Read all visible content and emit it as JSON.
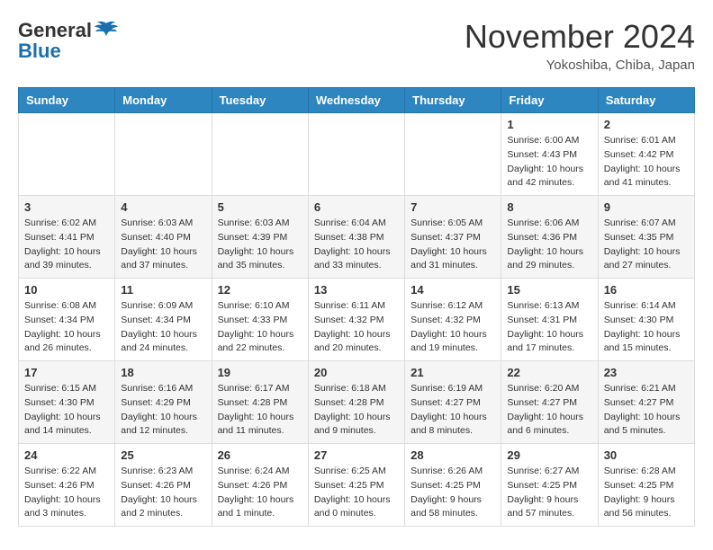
{
  "header": {
    "logo_line1": "General",
    "logo_line2": "Blue",
    "month": "November 2024",
    "location": "Yokoshiba, Chiba, Japan"
  },
  "weekdays": [
    "Sunday",
    "Monday",
    "Tuesday",
    "Wednesday",
    "Thursday",
    "Friday",
    "Saturday"
  ],
  "weeks": [
    [
      {
        "day": "",
        "info": ""
      },
      {
        "day": "",
        "info": ""
      },
      {
        "day": "",
        "info": ""
      },
      {
        "day": "",
        "info": ""
      },
      {
        "day": "",
        "info": ""
      },
      {
        "day": "1",
        "info": "Sunrise: 6:00 AM\nSunset: 4:43 PM\nDaylight: 10 hours\nand 42 minutes."
      },
      {
        "day": "2",
        "info": "Sunrise: 6:01 AM\nSunset: 4:42 PM\nDaylight: 10 hours\nand 41 minutes."
      }
    ],
    [
      {
        "day": "3",
        "info": "Sunrise: 6:02 AM\nSunset: 4:41 PM\nDaylight: 10 hours\nand 39 minutes."
      },
      {
        "day": "4",
        "info": "Sunrise: 6:03 AM\nSunset: 4:40 PM\nDaylight: 10 hours\nand 37 minutes."
      },
      {
        "day": "5",
        "info": "Sunrise: 6:03 AM\nSunset: 4:39 PM\nDaylight: 10 hours\nand 35 minutes."
      },
      {
        "day": "6",
        "info": "Sunrise: 6:04 AM\nSunset: 4:38 PM\nDaylight: 10 hours\nand 33 minutes."
      },
      {
        "day": "7",
        "info": "Sunrise: 6:05 AM\nSunset: 4:37 PM\nDaylight: 10 hours\nand 31 minutes."
      },
      {
        "day": "8",
        "info": "Sunrise: 6:06 AM\nSunset: 4:36 PM\nDaylight: 10 hours\nand 29 minutes."
      },
      {
        "day": "9",
        "info": "Sunrise: 6:07 AM\nSunset: 4:35 PM\nDaylight: 10 hours\nand 27 minutes."
      }
    ],
    [
      {
        "day": "10",
        "info": "Sunrise: 6:08 AM\nSunset: 4:34 PM\nDaylight: 10 hours\nand 26 minutes."
      },
      {
        "day": "11",
        "info": "Sunrise: 6:09 AM\nSunset: 4:34 PM\nDaylight: 10 hours\nand 24 minutes."
      },
      {
        "day": "12",
        "info": "Sunrise: 6:10 AM\nSunset: 4:33 PM\nDaylight: 10 hours\nand 22 minutes."
      },
      {
        "day": "13",
        "info": "Sunrise: 6:11 AM\nSunset: 4:32 PM\nDaylight: 10 hours\nand 20 minutes."
      },
      {
        "day": "14",
        "info": "Sunrise: 6:12 AM\nSunset: 4:32 PM\nDaylight: 10 hours\nand 19 minutes."
      },
      {
        "day": "15",
        "info": "Sunrise: 6:13 AM\nSunset: 4:31 PM\nDaylight: 10 hours\nand 17 minutes."
      },
      {
        "day": "16",
        "info": "Sunrise: 6:14 AM\nSunset: 4:30 PM\nDaylight: 10 hours\nand 15 minutes."
      }
    ],
    [
      {
        "day": "17",
        "info": "Sunrise: 6:15 AM\nSunset: 4:30 PM\nDaylight: 10 hours\nand 14 minutes."
      },
      {
        "day": "18",
        "info": "Sunrise: 6:16 AM\nSunset: 4:29 PM\nDaylight: 10 hours\nand 12 minutes."
      },
      {
        "day": "19",
        "info": "Sunrise: 6:17 AM\nSunset: 4:28 PM\nDaylight: 10 hours\nand 11 minutes."
      },
      {
        "day": "20",
        "info": "Sunrise: 6:18 AM\nSunset: 4:28 PM\nDaylight: 10 hours\nand 9 minutes."
      },
      {
        "day": "21",
        "info": "Sunrise: 6:19 AM\nSunset: 4:27 PM\nDaylight: 10 hours\nand 8 minutes."
      },
      {
        "day": "22",
        "info": "Sunrise: 6:20 AM\nSunset: 4:27 PM\nDaylight: 10 hours\nand 6 minutes."
      },
      {
        "day": "23",
        "info": "Sunrise: 6:21 AM\nSunset: 4:27 PM\nDaylight: 10 hours\nand 5 minutes."
      }
    ],
    [
      {
        "day": "24",
        "info": "Sunrise: 6:22 AM\nSunset: 4:26 PM\nDaylight: 10 hours\nand 3 minutes."
      },
      {
        "day": "25",
        "info": "Sunrise: 6:23 AM\nSunset: 4:26 PM\nDaylight: 10 hours\nand 2 minutes."
      },
      {
        "day": "26",
        "info": "Sunrise: 6:24 AM\nSunset: 4:26 PM\nDaylight: 10 hours\nand 1 minute."
      },
      {
        "day": "27",
        "info": "Sunrise: 6:25 AM\nSunset: 4:25 PM\nDaylight: 10 hours\nand 0 minutes."
      },
      {
        "day": "28",
        "info": "Sunrise: 6:26 AM\nSunset: 4:25 PM\nDaylight: 9 hours\nand 58 minutes."
      },
      {
        "day": "29",
        "info": "Sunrise: 6:27 AM\nSunset: 4:25 PM\nDaylight: 9 hours\nand 57 minutes."
      },
      {
        "day": "30",
        "info": "Sunrise: 6:28 AM\nSunset: 4:25 PM\nDaylight: 9 hours\nand 56 minutes."
      }
    ]
  ]
}
